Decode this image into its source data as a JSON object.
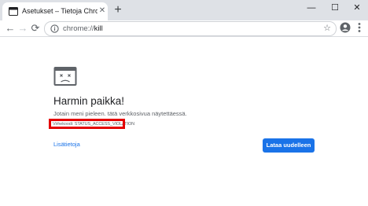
{
  "browser": {
    "tab": {
      "title": "Asetukset – Tietoja Chromesta",
      "close_glyph": "✕",
      "favicon": "settings-page-icon"
    },
    "new_tab_glyph": "+",
    "window_controls": {
      "minimize": "—",
      "maximize": "☐",
      "close": "✕"
    },
    "toolbar": {
      "back": "←",
      "forward": "→",
      "reload": "⟳",
      "star": "☆"
    },
    "address_bar": {
      "scheme": "chrome://",
      "path": "kill"
    }
  },
  "error_page": {
    "heading": "Harmin paikka!",
    "message": "Jotain meni pieleen. tätä verkkosivua näytettäessä.",
    "error_code": "Virhekoodi: STATUS_ACCESS_VIOLATION",
    "learn_more": "Lisätietoja",
    "reload_button": "Lataa uudelleen"
  },
  "colors": {
    "accent": "#1a73e8",
    "highlight_border": "#e40000",
    "titlebar": "#dee1e6"
  }
}
